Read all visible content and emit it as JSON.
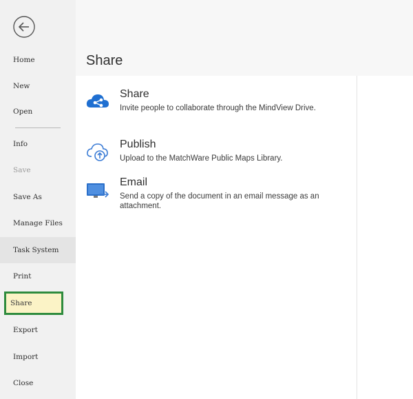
{
  "sidebar": {
    "items": [
      {
        "label": "Home"
      },
      {
        "label": "New"
      },
      {
        "label": "Open"
      },
      {
        "label": "Info"
      },
      {
        "label": "Save"
      },
      {
        "label": "Save As"
      },
      {
        "label": "Manage Files"
      },
      {
        "label": "Task System"
      },
      {
        "label": "Print"
      },
      {
        "label": "Share"
      },
      {
        "label": "Export"
      },
      {
        "label": "Import"
      },
      {
        "label": "Close"
      }
    ],
    "active_item": "Share",
    "disabled_item": "Save"
  },
  "page": {
    "title": "Share"
  },
  "options": [
    {
      "title": "Share",
      "description": "Invite people to collaborate through the MindView Drive.",
      "icon": "cloud-share-icon"
    },
    {
      "title": "Publish",
      "description": "Upload to the MatchWare Public Maps Library.",
      "icon": "cloud-upload-icon"
    },
    {
      "title": "Email",
      "description": "Send a copy of the document in an email message as an attachment.",
      "icon": "email-monitor-icon"
    }
  ],
  "colors": {
    "accent_blue": "#1f6fd1",
    "highlight_fill": "#fbf3c6",
    "highlight_border": "#2e8b3d",
    "sidebar_bg": "#f1f1f1"
  }
}
